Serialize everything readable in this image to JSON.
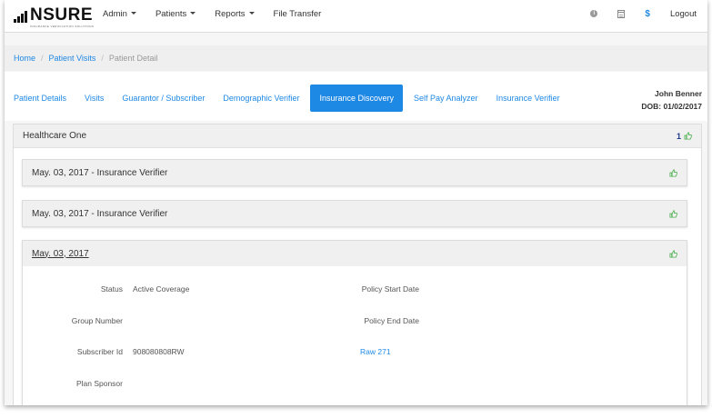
{
  "brand": {
    "name": "NSURE",
    "tagline": "INSURANCE VERIFICATION SOLUTIONS"
  },
  "nav": {
    "items": [
      {
        "label": "Admin",
        "has_caret": true
      },
      {
        "label": "Patients",
        "has_caret": true
      },
      {
        "label": "Reports",
        "has_caret": true
      },
      {
        "label": "File Transfer",
        "has_caret": false
      }
    ],
    "icons": [
      "info-icon",
      "calendar-icon",
      "dollar-icon"
    ],
    "dollar_symbol": "$",
    "info_symbol": "i",
    "logout_label": "Logout"
  },
  "breadcrumb": {
    "home": "Home",
    "patient_visits": "Patient Visits",
    "current": "Patient Detail"
  },
  "tabs": [
    {
      "label": "Patient Details",
      "active": false
    },
    {
      "label": "Visits",
      "active": false
    },
    {
      "label": "Guarantor / Subscriber",
      "active": false
    },
    {
      "label": "Demographic Verifier",
      "active": false
    },
    {
      "label": "Insurance Discovery",
      "active": true
    },
    {
      "label": "Self Pay Analyzer",
      "active": false
    },
    {
      "label": "Insurance Verifier",
      "active": false
    }
  ],
  "patient": {
    "name": "John Benner",
    "dob": "DOB: 01/02/2017"
  },
  "panel": {
    "title": "Healthcare One",
    "count": "1"
  },
  "entries": [
    {
      "title": "May. 03, 2017 - Insurance Verifier"
    },
    {
      "title": "May. 03, 2017 - Insurance Verifier"
    },
    {
      "title": "May. 03, 2017"
    }
  ],
  "details": {
    "status_label": "Status",
    "status_value": "Active Coverage",
    "group_label": "Group Number",
    "group_value": "",
    "subscriber_label": "Subscriber Id",
    "subscriber_value": "908080808RW",
    "sponsor_label": "Plan Sponsor",
    "sponsor_value": "",
    "policy_start_label": "Policy Start Date",
    "policy_end_label": "Policy End Date",
    "raw_link": "Raw 271"
  },
  "colors": {
    "accent": "#1e88e5",
    "thumb": "#4caf50",
    "count": "#1e3a8a"
  }
}
